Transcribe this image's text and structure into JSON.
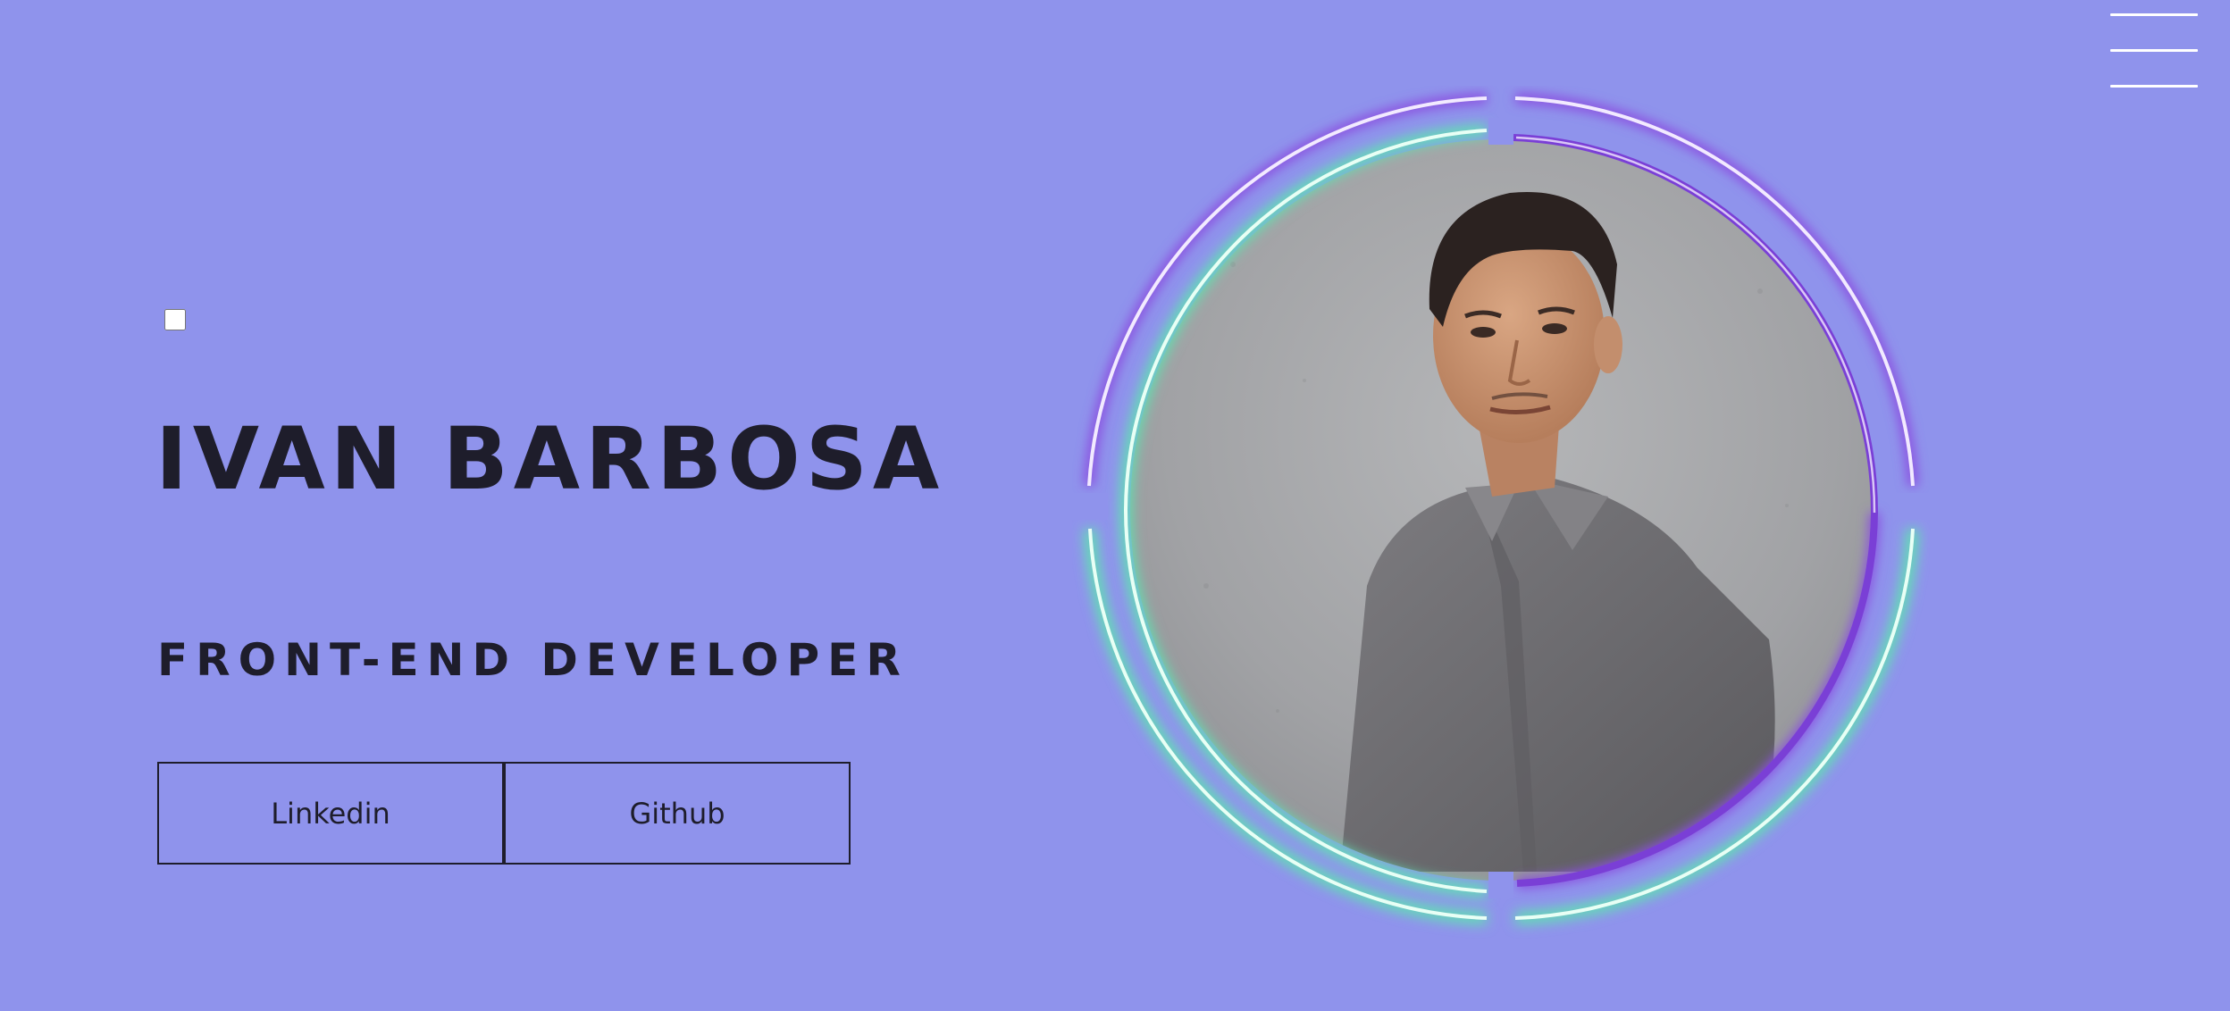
{
  "hero": {
    "name": "IVAN BARBOSA",
    "role": "FRONT-END DEVELOPER"
  },
  "links": [
    {
      "label": "Linkedin"
    },
    {
      "label": "Github"
    }
  ],
  "portrait": {
    "icon": "profile-photo"
  },
  "theme": {
    "toggle_checked": false
  },
  "colors": {
    "background": "#8f93ec",
    "text": "#1e1d2b",
    "ring_purple": "#8b4fe0",
    "ring_green": "#5fe3b0"
  }
}
